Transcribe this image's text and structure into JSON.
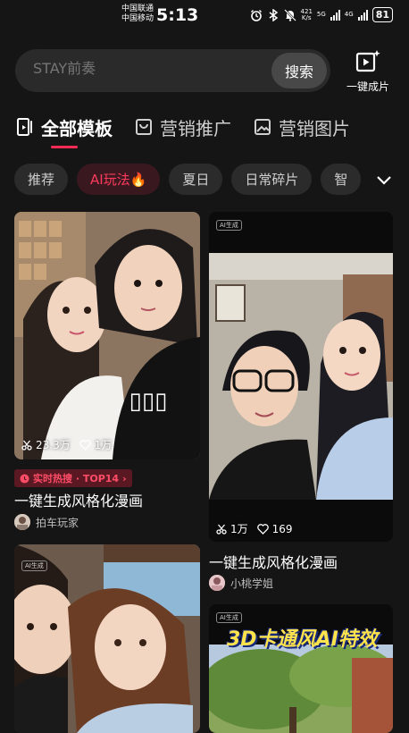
{
  "status_bar": {
    "carrier_1": "中国联通",
    "carrier_2": "中国移动",
    "time": "5:13",
    "network_speed": "421",
    "network_unit": "K/s",
    "sig_1": "5G",
    "sig_2": "4G",
    "battery": "81"
  },
  "search": {
    "placeholder": "STAY前奏",
    "button_label": "搜索"
  },
  "one_click": {
    "label": "一键成片",
    "icon": "video-sparkle-icon"
  },
  "tabs": [
    {
      "label": "全部模板",
      "icon": "template-icon",
      "active": true
    },
    {
      "label": "营销推广",
      "icon": "shopping-bag-icon",
      "active": false
    },
    {
      "label": "营销图片",
      "icon": "image-icon",
      "active": false
    }
  ],
  "chips": [
    {
      "label": "推荐",
      "active": false
    },
    {
      "label": "AI玩法🔥",
      "active": true
    },
    {
      "label": "夏日",
      "active": false
    },
    {
      "label": "日常碎片",
      "active": false
    },
    {
      "label": "智",
      "active": false
    }
  ],
  "colors": {
    "accent": "#fe2c55",
    "background": "#151515",
    "chip_bg": "#2b2b2b"
  },
  "cards": [
    {
      "uses": "23.3万",
      "likes": "1万",
      "hot_tag": "实时热搜 · TOP14",
      "title": "一键生成风格化漫画",
      "author": "拍车玩家"
    },
    {
      "ai_badge": "AI生成",
      "uses": "1万",
      "likes": "169",
      "title": "一键生成风格化漫画",
      "author": "小桃学姐"
    },
    {
      "ai_badge": "AI生成"
    },
    {
      "ai_badge": "AI生成",
      "banner": "3D卡通风AI特效"
    }
  ]
}
